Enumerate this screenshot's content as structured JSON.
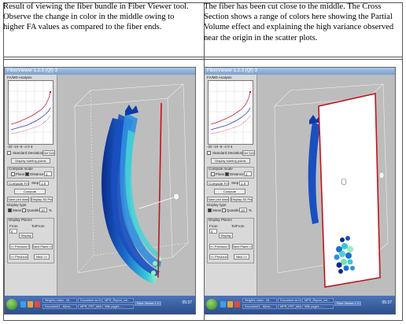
{
  "captions": {
    "left": "Result of viewing the fiber bundle in Fiber Viewer tool. Observe the change in color in the middle owing to higher FA values as compared to the fiber ends.",
    "right": "The fiber has been cut close to the middle. The Cross Section shows a range of colors here showing the Partial Volume effect and explaining the high variance observed near the origin in the scatter plots."
  },
  "window": {
    "title": "FiberViewer 1.2.3 (Qt) 3",
    "panel": {
      "plot_title": "FA/MD Analysis",
      "y_ticks": [
        "0.60",
        "0.50",
        "0.40",
        "0.30",
        "0.20",
        "0.10"
      ],
      "x_ticks": [
        "-20",
        "-10",
        "-8",
        "-4",
        "0",
        "4"
      ],
      "standard_deviation_label": "Standard Deviation",
      "set_scheme_button": "Set Scheme",
      "display_starting_points_button": "Display starting points",
      "compute_mode_label": "Compute mode",
      "by_plane_label": "Plane",
      "by_distance_label": "Distance",
      "distance_value": "1",
      "compute_fa_select": "Compute FA",
      "step_label": "Step",
      "step_value": "1.0",
      "compute_button": "Compute",
      "save_plot_button": "Save plot data",
      "display_3d_button": "Display 3D Plot",
      "display_type_label": "Display type",
      "mean_label": "Mean",
      "quantile_label": "Quantile",
      "quantile_value": "10",
      "percent_label": "%",
      "display_planes_label": "Display Planes",
      "planes_from_label": "From",
      "planes_to_label": "To/From",
      "planes_from_value": "0",
      "display_button": "Display",
      "previous_plane_button": "<< Previous Plane",
      "next_plane_button": "Next Plane >>",
      "previous_button": "<< Previous",
      "next_button": "Next >>"
    }
  },
  "taskbar": {
    "tasks_left": [
      "Wright's notes - Mi...",
      "Document1 - Micro...",
      "Document as the...",
      "MPR_FRT_Mine"
    ],
    "tasks_right": [
      "MPR_Report_ver...",
      "Wiki pages - ...",
      "Fiber Viewer 1.2.3"
    ],
    "clock": "05:37"
  },
  "colors": {
    "background": "#b8b8b8",
    "fiber_dark": "#0b2a8f",
    "fiber_mid": "#1e6fd0",
    "fiber_light": "#36c9d6",
    "fiber_highlight": "#a8f0c8",
    "cut_plane_border": "#c0141c",
    "taskbar": "#2b4f8e"
  }
}
